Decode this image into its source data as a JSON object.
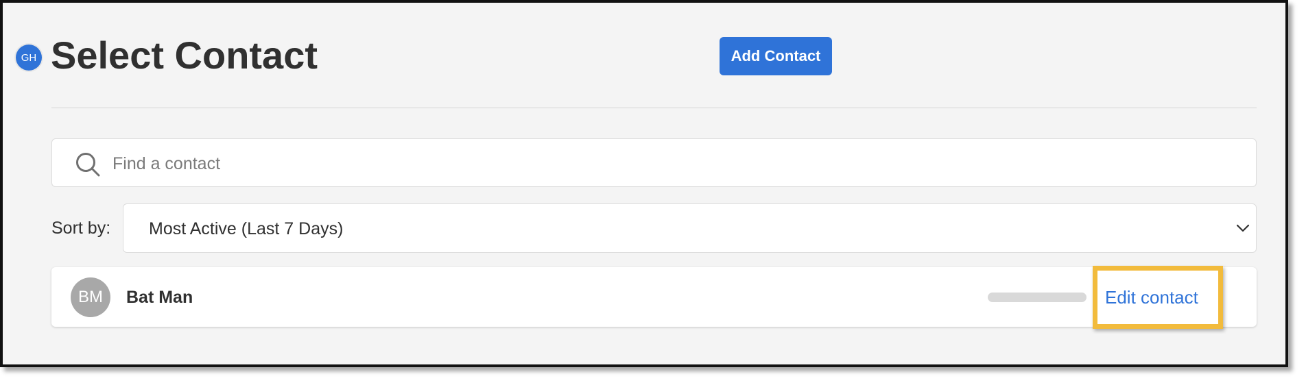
{
  "user": {
    "initials": "GH"
  },
  "header": {
    "title": "Select Contact",
    "add_button_label": "Add Contact"
  },
  "search": {
    "placeholder": "Find a contact",
    "value": ""
  },
  "sort": {
    "label": "Sort by:",
    "selected": "Most Active (Last 7 Days)"
  },
  "contacts": [
    {
      "initials": "BM",
      "name": "Bat Man",
      "action_label": "Edit contact"
    }
  ],
  "colors": {
    "accent": "#2f73d8",
    "highlight": "#f2bb3c",
    "avatar": "#a8a8a8",
    "background": "#f4f4f4"
  },
  "icons": {
    "search": "search-icon",
    "dropdown": "chevron-down-icon"
  }
}
